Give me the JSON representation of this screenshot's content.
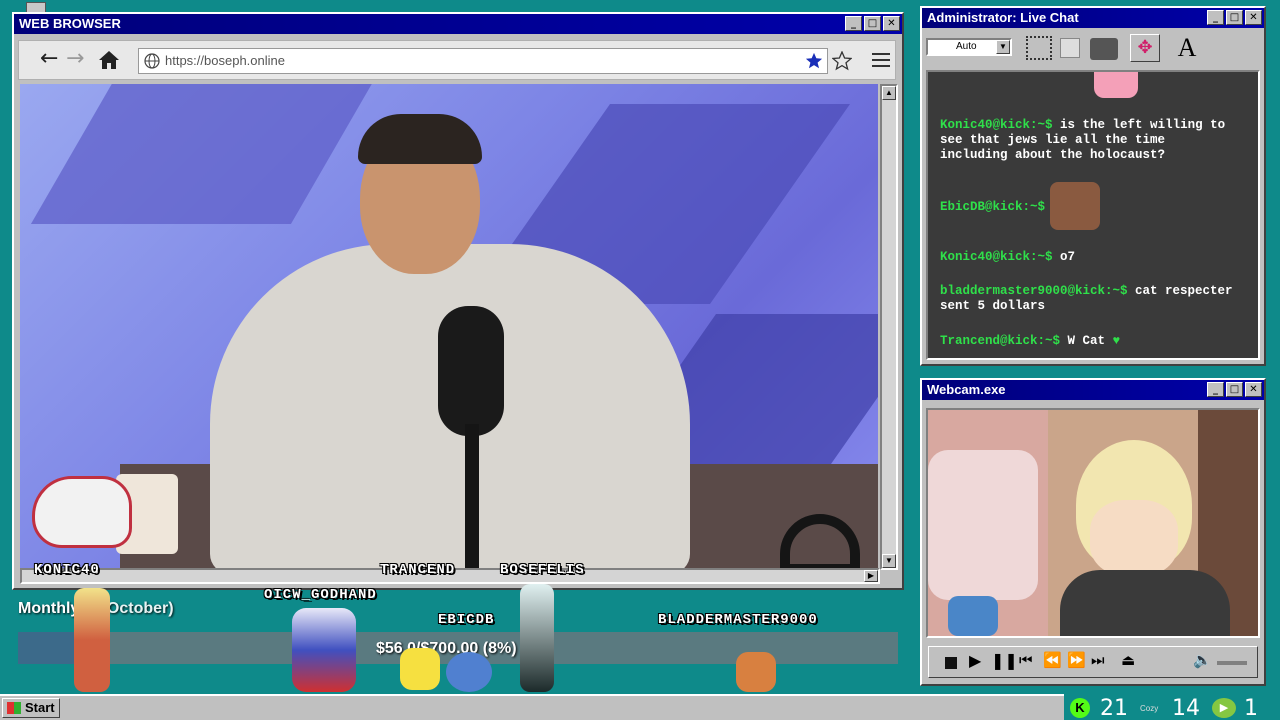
{
  "browser": {
    "title": "WEB BROWSER",
    "url": "https://boseph.online",
    "back_icon": "arrow-left",
    "forward_icon": "arrow-right",
    "home_icon": "home",
    "bookmark_icon": "star"
  },
  "chat": {
    "title": "Administrator: Live Chat",
    "font_select": "Auto",
    "messages": [
      {
        "user": "Konic40@kick:~$",
        "text": "is the left willing to see that jews lie all the time including about the holocaust?"
      },
      {
        "user": "EbicDB@kick:~$",
        "text": ""
      },
      {
        "user": "Konic40@kick:~$",
        "text": "o7"
      },
      {
        "user": "bladdermaster9000@kick:~$",
        "text": "cat respecter sent 5 dollars"
      },
      {
        "user": "Trancend@kick:~$",
        "text": "W Cat"
      }
    ]
  },
  "webcam": {
    "title": "Webcam.exe"
  },
  "goal": {
    "label": "Monthly Goal (October)",
    "label_visible": "Monthly",
    "label_end": "al (October)",
    "amount": "$56.0",
    "amount_rest": "/$700.00 (8",
    "amount_end": "%)",
    "progress": 0.08
  },
  "sprites": [
    {
      "name": "KONIC40"
    },
    {
      "name": "TRANCEND"
    },
    {
      "name": "BOSEFELIS"
    },
    {
      "name": "OICW_GODHAND"
    },
    {
      "name": "EBICDB"
    },
    {
      "name": "BLADDERMASTER9000"
    }
  ],
  "taskbar": {
    "start_label": "Start",
    "count_a": "21",
    "tray_label": "Cozy",
    "count_b": "14",
    "count_c": "1"
  },
  "colors": {
    "desktop": "#0e8a8a",
    "titlebar": "#0000aa",
    "chat_user": "#2fe04a",
    "kick_green": "#53fc18"
  }
}
